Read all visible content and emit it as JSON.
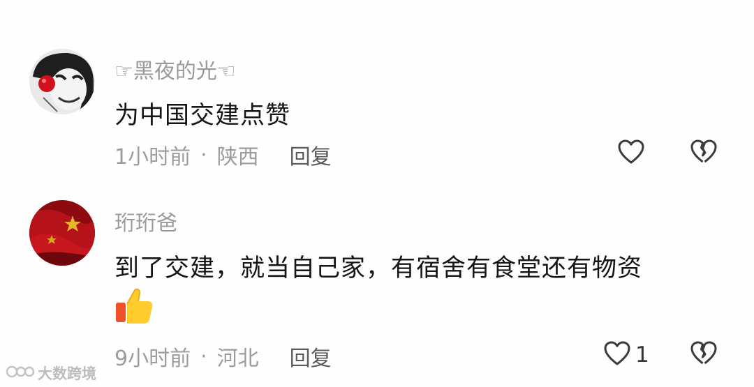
{
  "comments": [
    {
      "username": "☞黑夜的光☜",
      "text": "为中国交建点赞",
      "time": "1小时前",
      "separator": "·",
      "location": "陕西",
      "reply_label": "回复",
      "like_count": "",
      "avatar": "clown-face-avatar"
    },
    {
      "username": "珩珩爸",
      "text": "到了交建，就当自己家，有宿舍有食堂还有物资",
      "time": "9小时前",
      "separator": "·",
      "location": "河北",
      "reply_label": "回复",
      "like_count": "1",
      "avatar": "red-flag-avatar"
    }
  ],
  "watermark": {
    "text": "大数跨境",
    "icon": "logo-mark-icon"
  },
  "colors": {
    "text": "#151515",
    "muted": "#9c9c9c",
    "icon_stroke": "#3a3a3a"
  }
}
